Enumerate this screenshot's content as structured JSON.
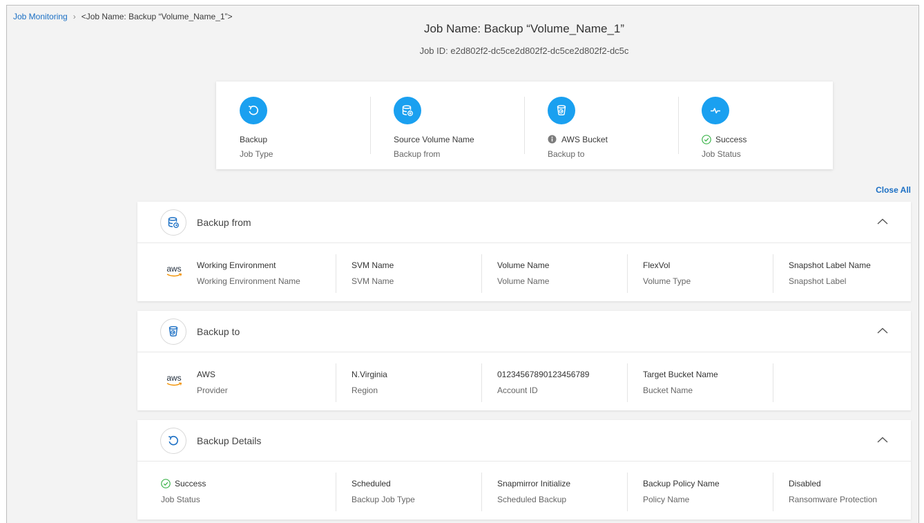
{
  "breadcrumb": {
    "root": "Job Monitoring",
    "separator": "›",
    "current": "<Job Name: Backup “Volume_Name_1”>"
  },
  "header": {
    "title": "Job Name: Backup “Volume_Name_1”",
    "job_id": "Job ID: e2d802f2-dc5ce2d802f2-dc5ce2d802f2-dc5c"
  },
  "summary": [
    {
      "icon": "undo-arrow-icon",
      "value": "Backup",
      "label": "Job Type"
    },
    {
      "icon": "database-add-icon",
      "value": "Source Volume Name",
      "label": "Backup from"
    },
    {
      "icon": "bucket-icon",
      "value": "AWS Bucket",
      "label": "Backup to"
    },
    {
      "icon": "pulse-icon",
      "value": "Success",
      "label": "Job Status"
    }
  ],
  "close_all": "Close All",
  "panels": {
    "backup_from": {
      "title": "Backup from",
      "provider_logo": "aws",
      "fields": [
        {
          "value": "Working Environment",
          "label": "Working Environment Name"
        },
        {
          "value": "SVM Name",
          "label": "SVM Name"
        },
        {
          "value": "Volume Name",
          "label": "Volume Name"
        },
        {
          "value": "FlexVol",
          "label": "Volume Type"
        },
        {
          "value": "Snapshot Label Name",
          "label": "Snapshot Label"
        }
      ]
    },
    "backup_to": {
      "title": "Backup to",
      "provider_logo": "aws",
      "fields": [
        {
          "value": "AWS",
          "label": "Provider"
        },
        {
          "value": "N.Virginia",
          "label": "Region"
        },
        {
          "value": "01234567890123456789",
          "label": "Account ID"
        },
        {
          "value": "Target Bucket Name",
          "label": "Bucket Name"
        }
      ]
    },
    "backup_details": {
      "title": "Backup Details",
      "fields": [
        {
          "value": "Success",
          "label": "Job Status"
        },
        {
          "value": "Scheduled",
          "label": "Backup Job Type"
        },
        {
          "value": "Snapmirror Initialize",
          "label": "Scheduled Backup"
        },
        {
          "value": "Backup Policy Name",
          "label": "Policy Name"
        },
        {
          "value": "Disabled",
          "label": "Ransomware Protection"
        }
      ]
    }
  },
  "colors": {
    "accent": "#1aa0f0",
    "link": "#1b6fc4",
    "success": "#3cb44b",
    "aws_orange": "#f29100"
  }
}
